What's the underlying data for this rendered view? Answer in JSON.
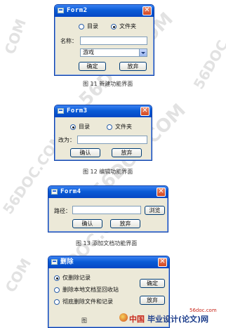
{
  "form2": {
    "title": "Form2",
    "close": "✕",
    "radio_dir": "目录",
    "radio_folder": "文件夹",
    "name_label": "名称：",
    "name_value": "",
    "select_value": "游戏",
    "ok_label": "确定",
    "cancel_label": "放弃"
  },
  "caption1": "图 11  新建功能界面",
  "form3": {
    "title": "Form3",
    "close": "✕",
    "radio_dir": "目录",
    "radio_folder": "文件夹",
    "rename_label": "改为：",
    "ok_label": "确认",
    "cancel_label": "放弃"
  },
  "caption2": "图 12  编辑功能界面",
  "form4": {
    "title": "Form4",
    "close": "✕",
    "path_label": "路径：",
    "browse_label": "浏览",
    "ok_label": "确认",
    "cancel_label": "放弃"
  },
  "caption3": "图 13  添加文档功能界面",
  "delete_dialog": {
    "title": "删除",
    "close": "✕",
    "option1": "仅删除记录",
    "option2": "删除本地文档至回收站",
    "option3": "彻底删除文件和记录",
    "ok_label": "确定",
    "cancel_label": "放弃"
  },
  "caption4_prefix": "图",
  "footer_brand": "中国",
  "footer_title": "毕业设计(论文)网",
  "footer_url": "56doc.com",
  "watermarks": [
    "56DOC.COM",
    "56DOC.COM",
    "56DOC.COM",
    "56DOC.COM",
    "COM",
    "COM",
    "56DOC"
  ]
}
